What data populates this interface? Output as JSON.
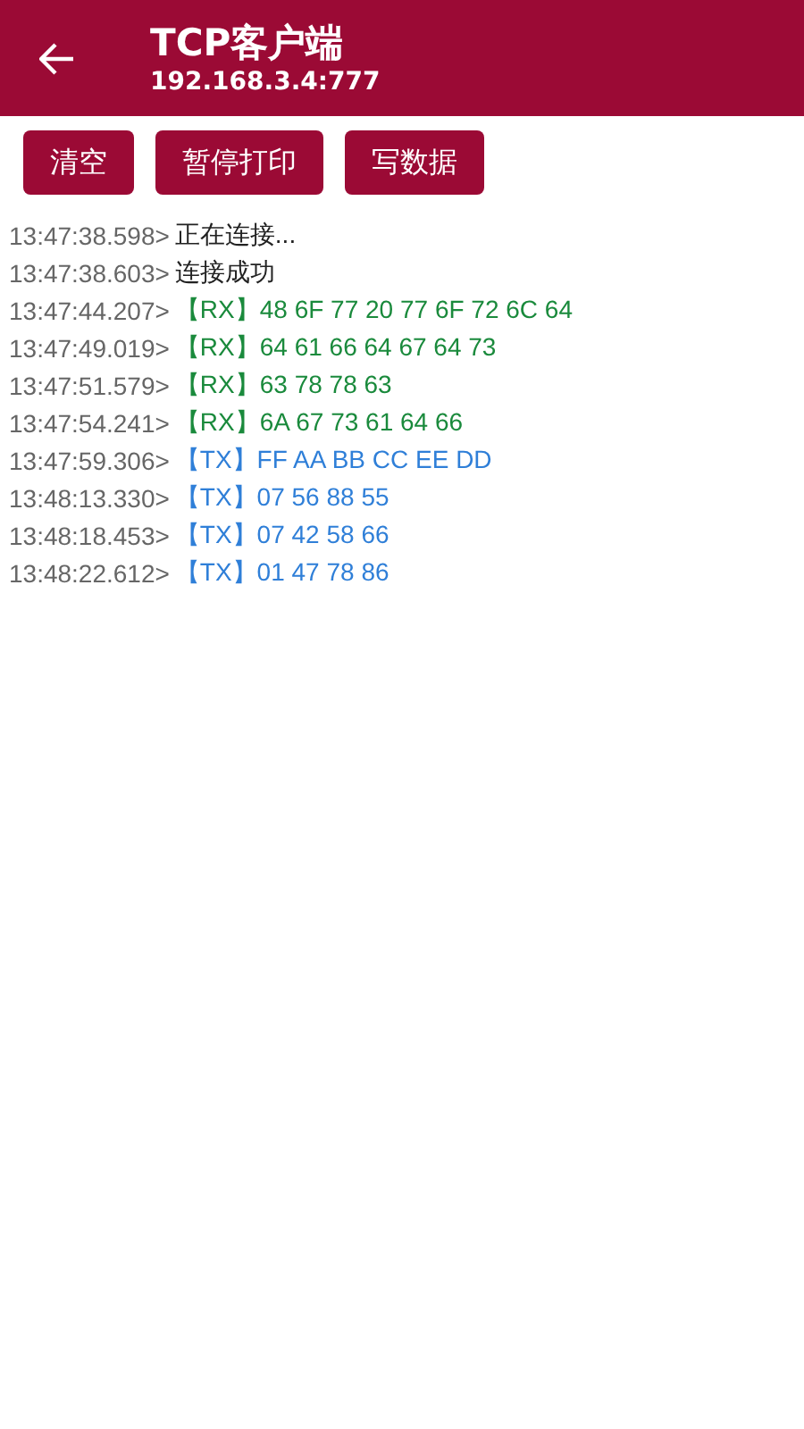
{
  "header": {
    "title": "TCP客户端",
    "subtitle": "192.168.3.4:777"
  },
  "buttons": [
    "清空",
    "暂停打印",
    "写数据"
  ],
  "log": [
    {
      "time": "13:47:38.598>",
      "kind": "info",
      "message": "正在连接..."
    },
    {
      "time": "13:47:38.603>",
      "kind": "info",
      "message": "连接成功"
    },
    {
      "time": "13:47:44.207>",
      "kind": "rx",
      "message": "【RX】48 6F 77 20 77 6F 72 6C 64"
    },
    {
      "time": "13:47:49.019>",
      "kind": "rx",
      "message": "【RX】64 61 66 64 67 64 73"
    },
    {
      "time": "13:47:51.579>",
      "kind": "rx",
      "message": "【RX】63 78 78 63"
    },
    {
      "time": "13:47:54.241>",
      "kind": "rx",
      "message": "【RX】6A 67 73 61 64 66"
    },
    {
      "time": "13:47:59.306>",
      "kind": "tx",
      "message": "【TX】FF AA BB CC EE DD"
    },
    {
      "time": "13:48:13.330>",
      "kind": "tx",
      "message": "【TX】07 56 88 55"
    },
    {
      "time": "13:48:18.453>",
      "kind": "tx",
      "message": "【TX】07 42 58 66"
    },
    {
      "time": "13:48:22.612>",
      "kind": "tx",
      "message": "【TX】01 47 78 86"
    }
  ]
}
